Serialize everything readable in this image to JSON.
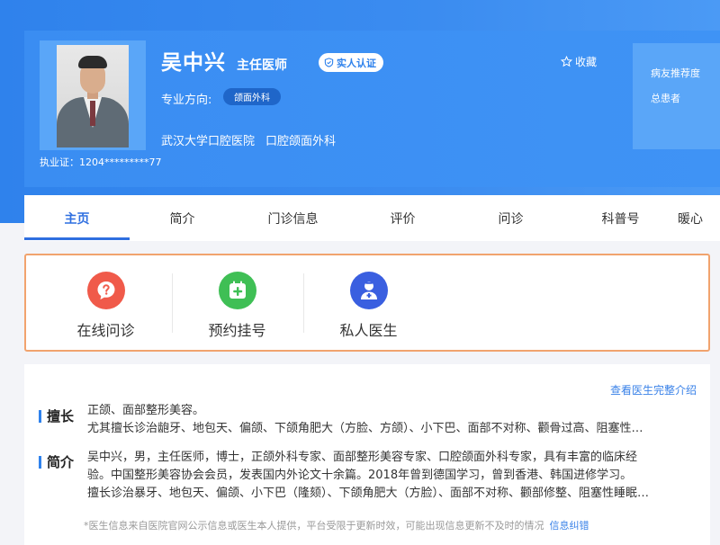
{
  "doctor": {
    "name": "吴中兴",
    "title": "主任医师",
    "verify_label": "实人认证",
    "specialty_label": "专业方向:",
    "specialty_tag": "颌面外科",
    "hospital": "武汉大学口腔医院",
    "department": "口腔颌面外科",
    "license": "执业证：1204*********77",
    "collect_label": "收藏",
    "stat_recommend": "病友推荐度",
    "stat_patients": "总患者"
  },
  "tabs": [
    {
      "label": "主页"
    },
    {
      "label": "简介"
    },
    {
      "label": "门诊信息"
    },
    {
      "label": "评价"
    },
    {
      "label": "问诊"
    },
    {
      "label": "科普号"
    },
    {
      "label": "暖心"
    }
  ],
  "services": [
    {
      "label": "在线问诊",
      "icon": "question-chat-icon",
      "color": "#f05a4a"
    },
    {
      "label": "预约挂号",
      "icon": "plus-calendar-icon",
      "color": "#3fbf55"
    },
    {
      "label": "私人医生",
      "icon": "doctor-icon",
      "color": "#3a5fe0"
    }
  ],
  "profile": {
    "more_link": "查看医生完整介绍",
    "expertise_heading": "擅长",
    "expertise_lines": [
      "正颌、面部整形美容。",
      "尤其擅长诊治龅牙、地包天、偏颌、下颌角肥大（方脸、方颌）、小下巴、面部不对称、颧骨过高、阻塞性…"
    ],
    "intro_heading": "简介",
    "intro_lines": [
      "吴中兴，男，主任医师，博士，正颌外科专家、面部整形美容专家、口腔颌面外科专家，具有丰富的临床经",
      "验。中国整形美容协会会员，发表国内外论文十余篇。2018年曾到德国学习，曾到香港、韩国进修学习。",
      "擅长诊治暴牙、地包天、偏颌、小下巴（隆颏）、下颌角肥大（方脸）、面部不对称、颧部修整、阻塞性睡眠…"
    ],
    "footnote": "*医生信息来自医院官网公示信息或医生本人提供，平台受限于更新时效，可能出现信息更新不及时的情况",
    "correction_link": "信息纠错"
  },
  "colors": {
    "brand_blue": "#2f82ec",
    "active_tab": "#2f6fe0",
    "service_border": "#f1a36e"
  }
}
